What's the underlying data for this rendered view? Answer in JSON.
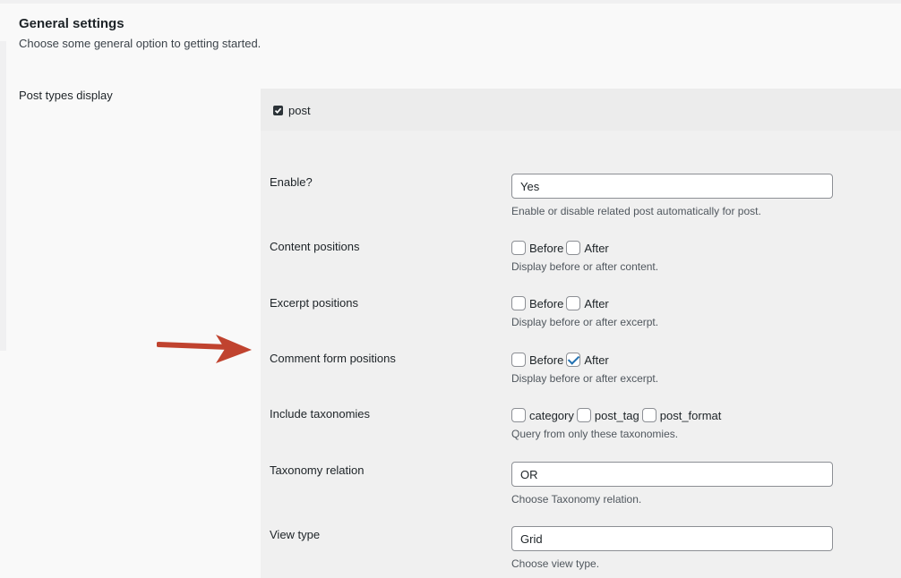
{
  "section": {
    "title": "General settings",
    "description": "Choose some general option to getting started."
  },
  "post_types": {
    "label": "Post types display",
    "post_label": "post",
    "post_checked": true
  },
  "fields": {
    "enable": {
      "label": "Enable?",
      "value": "Yes",
      "desc": "Enable or disable related post automatically for post."
    },
    "content_positions": {
      "label": "Content positions",
      "options": [
        {
          "label": "Before",
          "checked": false
        },
        {
          "label": "After",
          "checked": false
        }
      ],
      "desc": "Display before or after content."
    },
    "excerpt_positions": {
      "label": "Excerpt positions",
      "options": [
        {
          "label": "Before",
          "checked": false
        },
        {
          "label": "After",
          "checked": false
        }
      ],
      "desc": "Display before or after excerpt."
    },
    "comment_form_positions": {
      "label": "Comment form positions",
      "options": [
        {
          "label": "Before",
          "checked": false
        },
        {
          "label": "After",
          "checked": true
        }
      ],
      "desc": "Display before or after excerpt."
    },
    "include_taxonomies": {
      "label": "Include taxonomies",
      "options": [
        {
          "label": "category",
          "checked": false
        },
        {
          "label": "post_tag",
          "checked": false
        },
        {
          "label": "post_format",
          "checked": false
        }
      ],
      "desc": "Query from only these taxonomies."
    },
    "taxonomy_relation": {
      "label": "Taxonomy relation",
      "value": "OR",
      "desc": "Choose Taxonomy relation."
    },
    "view_type": {
      "label": "View type",
      "value": "Grid",
      "desc": "Choose view type."
    }
  },
  "annotation": {
    "arrow_color": "#c0432f",
    "icon": "arrow-right-icon"
  }
}
